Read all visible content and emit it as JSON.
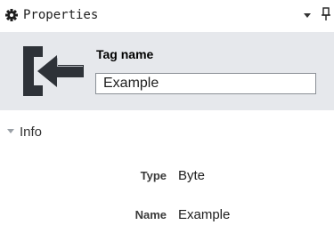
{
  "panel": {
    "title": "Properties",
    "icons": {
      "settings": "gear-icon",
      "options": "dropdown-arrow-icon",
      "pin": "pin-icon"
    }
  },
  "header": {
    "icon": "tag-arrow-icon",
    "tag_label": "Tag name",
    "tag_value": "Example"
  },
  "info": {
    "label": "Info",
    "expanded": true,
    "properties": [
      {
        "key": "Type",
        "value": "Byte"
      },
      {
        "key": "Name",
        "value": "Example"
      }
    ]
  },
  "colors": {
    "header_background": "#e6e8ec",
    "icon_dark": "#2e3238",
    "icon_light": "#b5b9bf"
  }
}
